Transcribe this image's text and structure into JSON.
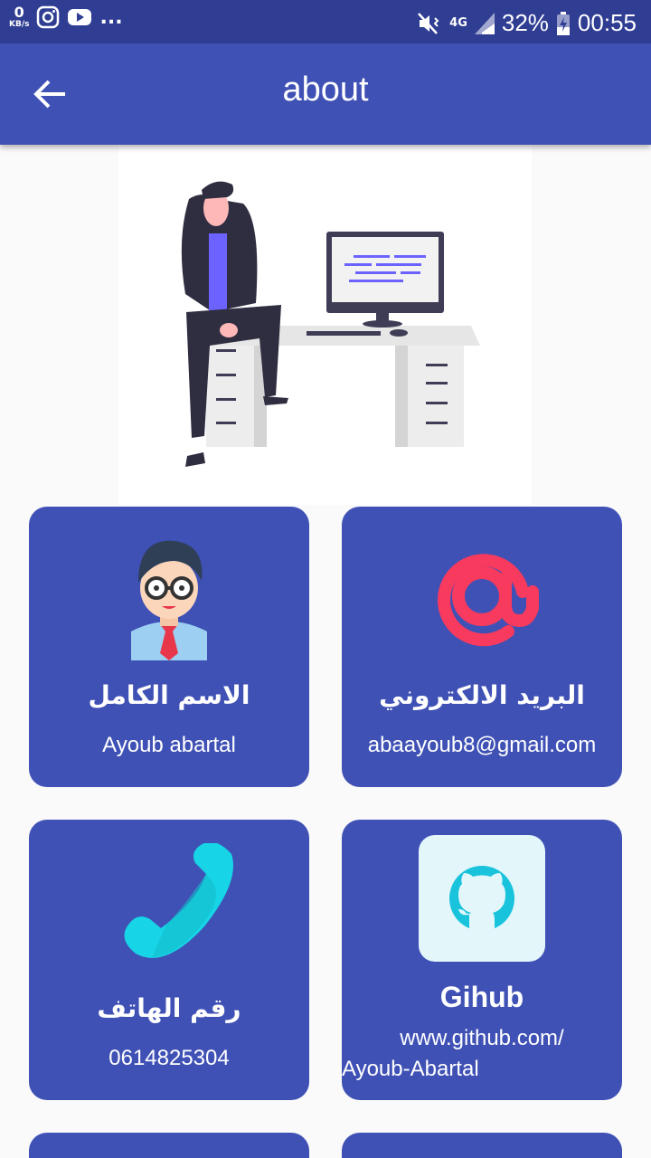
{
  "status": {
    "speed_value": "0",
    "speed_unit": "KB/s",
    "more": "...",
    "network": "4G",
    "battery": "32%",
    "time": "00:55"
  },
  "appbar": {
    "title": "about"
  },
  "cards": {
    "name": {
      "label": "الاسم الكامل",
      "value": "Ayoub abartal"
    },
    "email": {
      "label": "البريد الالكتروني",
      "value": "abaayoub8@gmail.com"
    },
    "phone": {
      "label": "رقم الهاتف",
      "value": "0614825304"
    },
    "github": {
      "label": "Gihub",
      "value_line1": "www.github.com/",
      "value_line2": "Ayoub-Abartal"
    }
  },
  "colors": {
    "primary": "#3f51b5",
    "status_bar": "#2f3d93",
    "email_icon": "#f73a5e",
    "phone_icon": "#17d5e6"
  }
}
